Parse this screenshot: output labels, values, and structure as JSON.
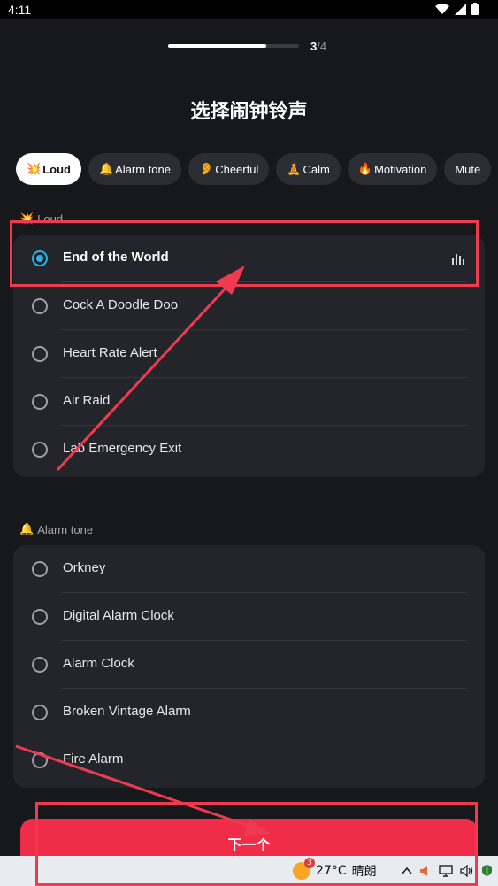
{
  "status_bar": {
    "time": "4:11",
    "icons": [
      "wifi-icon",
      "signal-icon",
      "battery-icon"
    ]
  },
  "progress": {
    "current": "3",
    "total": "/4",
    "fraction": 0.75
  },
  "title": "选择闹钟铃声",
  "chips": [
    {
      "emoji": "💥",
      "label": "Loud",
      "active": true
    },
    {
      "emoji": "🔔",
      "label": "Alarm tone",
      "active": false
    },
    {
      "emoji": "👂",
      "label": "Cheerful",
      "active": false
    },
    {
      "emoji": "🧘",
      "label": "Calm",
      "active": false
    },
    {
      "emoji": "🔥",
      "label": "Motivation",
      "active": false
    },
    {
      "emoji": "",
      "label": "Mute",
      "active": false
    }
  ],
  "sections": [
    {
      "emoji": "💥",
      "title": "Loud",
      "items": [
        {
          "label": "End of the World",
          "selected": true
        },
        {
          "label": "Cock A Doodle Doo",
          "selected": false
        },
        {
          "label": "Heart Rate Alert",
          "selected": false
        },
        {
          "label": "Air Raid",
          "selected": false
        },
        {
          "label": "Lab Emergency Exit",
          "selected": false
        }
      ]
    },
    {
      "emoji": "🔔",
      "title": "Alarm tone",
      "items": [
        {
          "label": "Orkney",
          "selected": false
        },
        {
          "label": "Digital Alarm Clock",
          "selected": false
        },
        {
          "label": "Alarm Clock",
          "selected": false
        },
        {
          "label": "Broken Vintage Alarm",
          "selected": false
        },
        {
          "label": "Fire Alarm",
          "selected": false
        }
      ]
    }
  ],
  "next_button": "下一个",
  "taskbar": {
    "weather_badge": "3",
    "temperature": "27°C",
    "condition": "晴朗"
  },
  "colors": {
    "accent": "#2ab4e6",
    "cta": "#ef2d48",
    "annotation": "#ee3b4f"
  }
}
